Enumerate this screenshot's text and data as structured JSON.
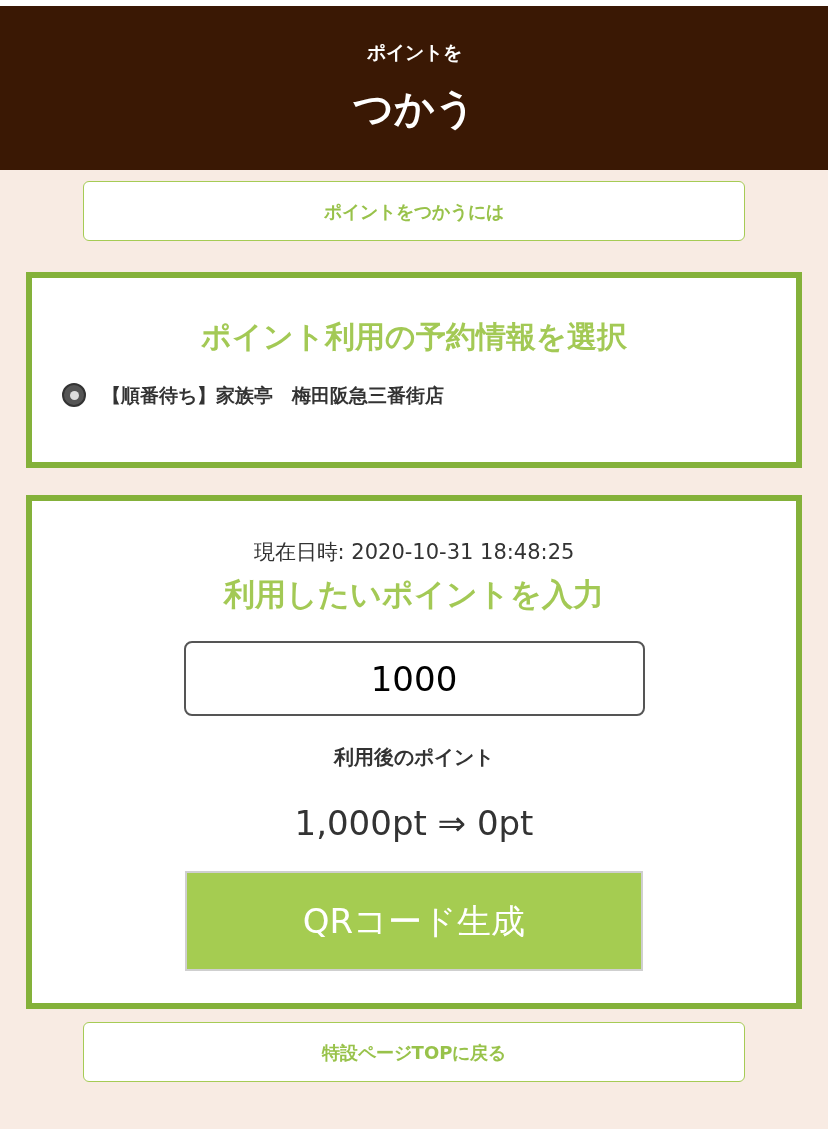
{
  "header": {
    "subtitle": "ポイントを",
    "title": "つかう"
  },
  "help_link": "ポイントをつかうには",
  "reservation": {
    "heading": "ポイント利用の予約情報を選択",
    "options": [
      {
        "label": "【順番待ち】家族亭　梅田阪急三番街店",
        "selected": true
      }
    ]
  },
  "points": {
    "datetime": "現在日時: 2020-10-31 18:48:25",
    "heading": "利用したいポイントを入力",
    "value": "1000",
    "after_label": "利用後のポイント",
    "after_value": "1,000pt ⇒ 0pt",
    "button": "QRコード生成"
  },
  "back_link": "特設ページTOPに戻る"
}
